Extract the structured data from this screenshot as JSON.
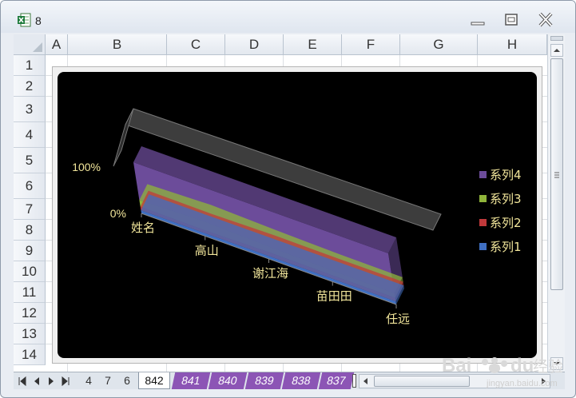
{
  "window": {
    "title": "8"
  },
  "columns": [
    "A",
    "B",
    "C",
    "D",
    "E",
    "F",
    "G",
    "H"
  ],
  "rows": [
    "1",
    "2",
    "3",
    "4",
    "5",
    "6",
    "7",
    "8",
    "9",
    "10",
    "11",
    "12",
    "13",
    "14"
  ],
  "chart_data": {
    "type": "area",
    "stacked": "100%",
    "three_d": true,
    "categories": [
      "姓名",
      "高山",
      "谢江海",
      "苗田田",
      "任远"
    ],
    "series": [
      {
        "name": "系列1",
        "values": [
          6,
          6,
          6,
          6,
          6
        ],
        "color": "#3f6fc2"
      },
      {
        "name": "系列2",
        "values": [
          7,
          6,
          8,
          7,
          7
        ],
        "color": "#c0393b"
      },
      {
        "name": "系列3",
        "values": [
          13,
          18,
          12,
          10,
          9
        ],
        "color": "#8fb43a"
      },
      {
        "name": "系列4",
        "values": [
          74,
          70,
          74,
          77,
          78
        ],
        "color": "#6c4c9a"
      }
    ],
    "y_ticks": [
      "0%",
      "100%"
    ],
    "legend_position": "right",
    "background": "#000000"
  },
  "sheet_tabs": {
    "plain": [
      "4",
      "7",
      "6"
    ],
    "active": "842",
    "colored": [
      "841",
      "840",
      "839",
      "838",
      "837"
    ]
  },
  "watermark": {
    "brand": "Bai",
    "brand2": "du",
    "suffix": "经验",
    "url": "jingyan.baidu.com"
  }
}
